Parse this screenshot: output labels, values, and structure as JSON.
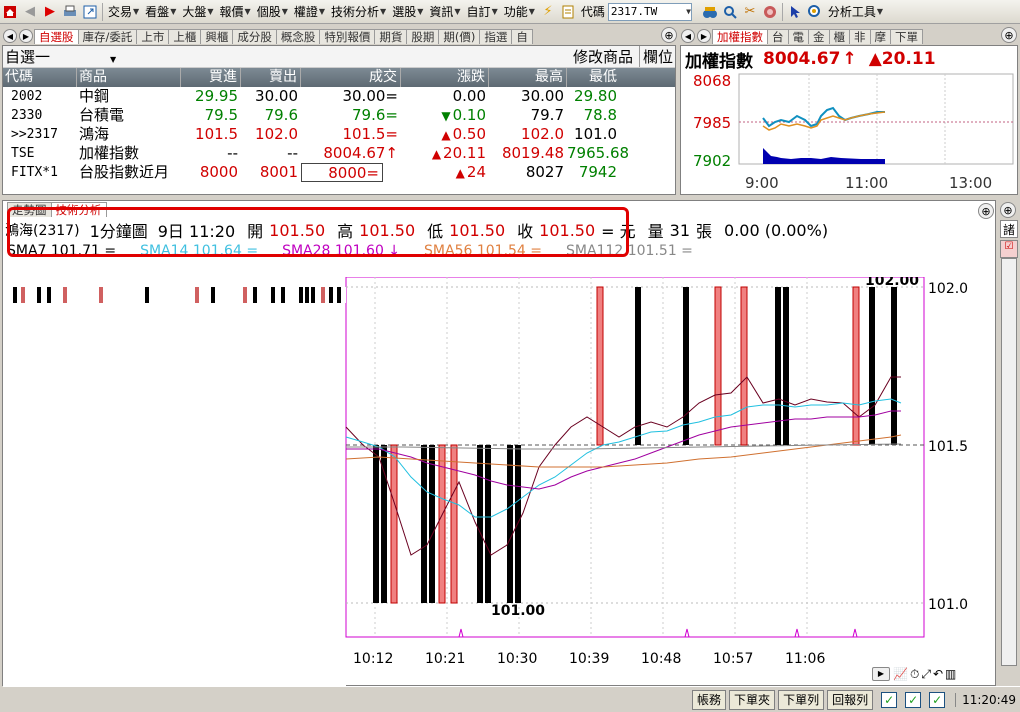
{
  "toolbar": {
    "items": [
      "交易",
      "看盤",
      "大盤",
      "報價",
      "個股",
      "權證",
      "技術分析",
      "選股",
      "資訊",
      "自訂",
      "功能"
    ],
    "code_label": "代碼",
    "code_value": "2317.TW",
    "analysis_tool": "分析工具"
  },
  "quote": {
    "tabs": [
      "自選股",
      "庫存/委託",
      "上市",
      "上櫃",
      "興櫃",
      "成分股",
      "概念股",
      "特別報價",
      "期貨",
      "股期",
      "期(價)",
      "指選",
      "自"
    ],
    "group_name": "自選一",
    "edit_label": "修改商品",
    "columns_label": "欄位",
    "headers": [
      "代碼",
      "商品",
      "買進",
      "賣出",
      "成交",
      "漲跌",
      "最高",
      "最低"
    ],
    "rows": [
      {
        "code": "2002",
        "name": "中鋼",
        "bid": "29.95",
        "ask": "30.00",
        "last": "30.00",
        "mark": "=",
        "dir": "",
        "change": "0.00",
        "high": "30.00",
        "low": "29.80"
      },
      {
        "code": "2330",
        "name": "台積電",
        "bid": "79.5",
        "ask": "79.6",
        "last": "79.6",
        "mark": "=",
        "dir": "▼",
        "change": "0.10",
        "high": "79.7",
        "low": "78.8"
      },
      {
        "code": ">>2317",
        "name": "鴻海",
        "bid": "101.5",
        "ask": "102.0",
        "last": "101.5",
        "mark": "=",
        "dir": "▲",
        "change": "0.50",
        "high": "102.0",
        "low": "101.0"
      },
      {
        "code": "TSE",
        "name": "加權指數",
        "bid": "--",
        "ask": "--",
        "last": "8004.67",
        "mark": "↑",
        "dir": "▲",
        "change": "20.11",
        "high": "8019.48",
        "low": "7965.68"
      },
      {
        "code": "FITX*1",
        "name": "台股指數近月",
        "bid": "8000",
        "ask": "8001",
        "last": "8000",
        "mark": "=",
        "dir": "▲",
        "change": "24",
        "high": "8027",
        "low": "7942"
      }
    ]
  },
  "index_panel": {
    "tabs": [
      "加權指數",
      "台",
      "電",
      "金",
      "櫃",
      "非",
      "摩",
      "下單"
    ],
    "title": "加權指數",
    "value": "8004.67",
    "arrow": "↑",
    "change": "▲20.11",
    "y_labels": [
      "8068",
      "7985",
      "7902"
    ],
    "x_labels": [
      "9:00",
      "11:00",
      "13:00"
    ]
  },
  "tech_panel": {
    "tabs": [
      "走勢圖",
      "技術分析"
    ],
    "info": {
      "name": "鴻海(2317)",
      "period": "1分鐘圖",
      "date": "9日 11:20",
      "open_label": "開",
      "open": "101.50",
      "high_label": "高",
      "high": "101.50",
      "low_label": "低",
      "low": "101.50",
      "close_label": "收",
      "close": "101.50",
      "unit": "= 元",
      "vol_label": "量",
      "vol": "31",
      "vol_unit": "張",
      "change": "0.00 (0.00%)"
    },
    "ma": [
      "SMA7 101.71 =",
      "SMA14 101.64 =",
      "SMA28 101.60 ↓",
      "SMA56 101.54 =",
      "SMA112 101.51 ="
    ],
    "y_labels": [
      "102.0",
      "101.5",
      "101.0"
    ],
    "x_labels": [
      "10:12",
      "10:21",
      "10:30",
      "10:39",
      "10:48",
      "10:57",
      "11:06"
    ],
    "max_label": "102.00",
    "min_label": "101.00"
  },
  "status": {
    "buttons": [
      "帳務",
      "下單夾",
      "下單列",
      "回報列"
    ],
    "time": "11:20:49"
  },
  "colors": {
    "accent_red": "#d00000",
    "green": "#008000",
    "highlight_box": "#e00000"
  }
}
